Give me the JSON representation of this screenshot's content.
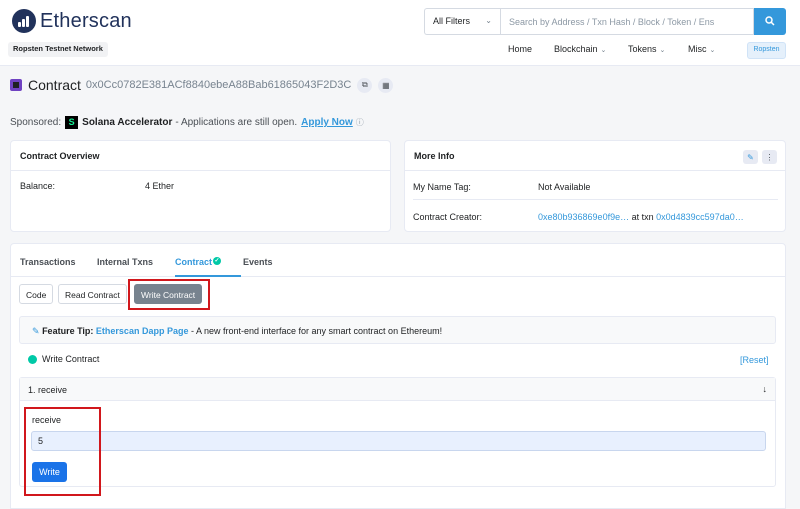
{
  "brand": {
    "name": "Etherscan",
    "network_badge": "Ropsten Testnet Network"
  },
  "search": {
    "filter_label": "All Filters",
    "placeholder": "Search by Address / Txn Hash / Block / Token / Ens"
  },
  "nav": {
    "home": "Home",
    "blockchain": "Blockchain",
    "tokens": "Tokens",
    "misc": "Misc",
    "network_button": "Ropsten"
  },
  "contract": {
    "title": "Contract",
    "address": "0x0Cc0782E381ACf8840ebeA88Bab61865043F2D3C"
  },
  "sponsored": {
    "label": "Sponsored:",
    "sponsor_name": "Solana Accelerator",
    "text": "- Applications are still open.",
    "link": "Apply Now"
  },
  "overview": {
    "title": "Contract Overview",
    "balance_label": "Balance:",
    "balance_value": "4 Ether"
  },
  "more_info": {
    "title": "More Info",
    "name_tag_label": "My Name Tag:",
    "name_tag_value": "Not Available",
    "creator_label": "Contract Creator:",
    "creator_address": "0xe80b936869e0f9e…",
    "at_txn": "at txn",
    "creator_txn": "0x0d4839cc597da0…"
  },
  "tabs": [
    "Transactions",
    "Internal Txns",
    "Contract",
    "Events"
  ],
  "sub_buttons": [
    "Code",
    "Read Contract",
    "Write Contract"
  ],
  "feature_tip": {
    "label": "Feature Tip:",
    "link": "Etherscan Dapp Page",
    "text": "- A new front-end interface for any smart contract on Ethereum!"
  },
  "write_section": {
    "status": "Write Contract",
    "reset": "[Reset]"
  },
  "function": {
    "header": "1. receive",
    "param_label": "receive",
    "input_value": "5",
    "button": "Write"
  },
  "colors": {
    "accent": "#3498db",
    "annotation": "#d1171c",
    "success": "#00c9a7"
  }
}
